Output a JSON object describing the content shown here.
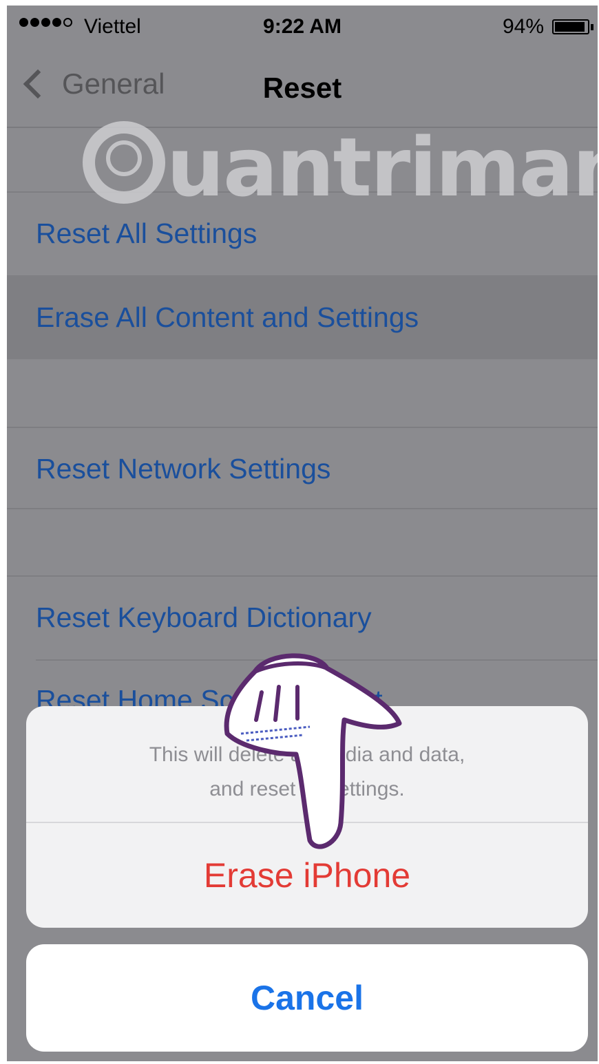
{
  "status_bar": {
    "carrier": "Viettel",
    "time": "9:22 AM",
    "battery_percent": "94%",
    "battery_level": 0.94,
    "signal_bars": 4
  },
  "nav": {
    "back_label": "General",
    "title": "Reset"
  },
  "watermark": {
    "text": "uantrimang"
  },
  "list": {
    "reset_all_settings": "Reset All Settings",
    "erase_all_content": "Erase All Content and Settings",
    "reset_network": "Reset Network Settings",
    "reset_keyboard": "Reset Keyboard Dictionary",
    "reset_home_screen": "Reset Home Screen Layout"
  },
  "action_sheet": {
    "message_line1": "This will delete all media and data,",
    "message_line2": "and reset all settings.",
    "destructive_button": "Erase iPhone",
    "cancel_button": "Cancel"
  },
  "colors": {
    "dimmed_background": "#8b8b8f",
    "link_blue": "#1a4f9c",
    "destructive_red": "#e33b35",
    "cancel_blue": "#1a73e8",
    "hand_outline": "#5b2a6e"
  }
}
